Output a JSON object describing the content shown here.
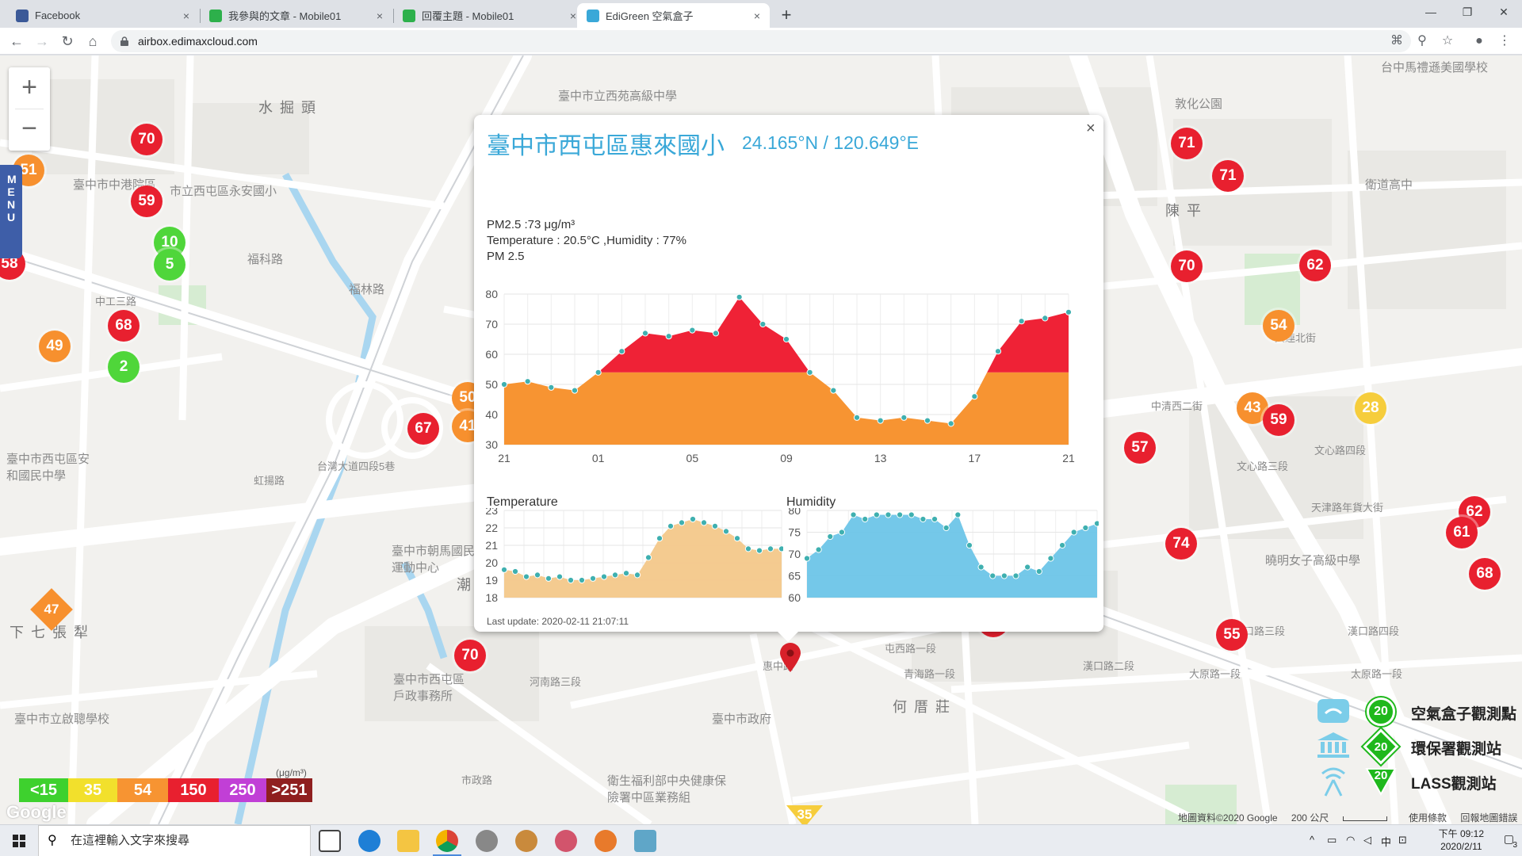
{
  "browser": {
    "tabs": [
      {
        "title": "Facebook",
        "icon": "facebook-icon",
        "color": "#3b5998"
      },
      {
        "title": "我參與的文章 - Mobile01",
        "icon": "mobile01-icon",
        "color": "#2db04b"
      },
      {
        "title": "回覆主題 - Mobile01",
        "icon": "mobile01-icon",
        "color": "#2db04b"
      },
      {
        "title": "EdiGreen 空氣盒子",
        "icon": "edigreen-icon",
        "color": "#3aa8d8"
      }
    ],
    "active_tab": 3,
    "url": "airbox.edimaxcloud.com",
    "new_tab_symbol": "+",
    "close_symbol": "×"
  },
  "map": {
    "zoom_in": "+",
    "zoom_out": "−",
    "menu_label": "MENU",
    "place_labels": [
      "水 掘 頭",
      "臺中市立西苑高級中學",
      "市立西屯區永安國小",
      "臺中市中港院區",
      "福科路",
      "福林路",
      "敦化公園",
      "臺中市西屯區安和國民中學",
      "台灣大道四段5巷",
      "虹揚路",
      "臺中市朝馬國民運動中心",
      "下 七 張 犁",
      "臺中市立啟聰學校",
      "臺中市西屯區戶政事務所",
      "臺中市政府",
      "衛生福利部中央健康保險署中區業務組",
      "何 厝 莊",
      "陳 平",
      "衛道高中",
      "台中馬禮遜美國學校",
      "文心路三段",
      "文心路四段",
      "天津路年貨大街",
      "曉明女子高級中學",
      "漢口路三段",
      "漢口路四段",
      "太原路一段",
      "大原路一段",
      "中清西二街",
      "大連北街",
      "潮",
      "屯西路一段",
      "青海路一段",
      "市政路",
      "惠中路",
      "河南路三段",
      "中工三路",
      "漢口路二段"
    ],
    "markers": [
      {
        "value": "51",
        "level": "orange"
      },
      {
        "value": "70",
        "level": "red"
      },
      {
        "value": "59",
        "level": "red"
      },
      {
        "value": "10",
        "level": "green"
      },
      {
        "value": "5",
        "level": "green"
      },
      {
        "value": "58",
        "level": "red"
      },
      {
        "value": "68",
        "level": "red"
      },
      {
        "value": "49",
        "level": "orange"
      },
      {
        "value": "2",
        "level": "green"
      },
      {
        "value": "50",
        "level": "orange"
      },
      {
        "value": "41",
        "level": "orange"
      },
      {
        "value": "67",
        "level": "red"
      },
      {
        "value": "71",
        "level": "red"
      },
      {
        "value": "71",
        "level": "red"
      },
      {
        "value": "70",
        "level": "red"
      },
      {
        "value": "62",
        "level": "red"
      },
      {
        "value": "54",
        "level": "orange"
      },
      {
        "value": "43",
        "level": "orange"
      },
      {
        "value": "59",
        "level": "red"
      },
      {
        "value": "28",
        "level": "yellow"
      },
      {
        "value": "57",
        "level": "red"
      },
      {
        "value": "74",
        "level": "red"
      },
      {
        "value": "62",
        "level": "red"
      },
      {
        "value": "61",
        "level": "red"
      },
      {
        "value": "68",
        "level": "red"
      },
      {
        "value": "62",
        "level": "red"
      },
      {
        "value": "55",
        "level": "red"
      },
      {
        "value": "70",
        "level": "red"
      },
      {
        "value": "64",
        "level": "red"
      },
      {
        "value": "73",
        "level": "red"
      },
      {
        "value": "47",
        "level": "orange"
      },
      {
        "value": "35",
        "level": "yellow"
      }
    ],
    "legend": {
      "unit": "(μg/m³)",
      "items": [
        {
          "label": "<15",
          "color": "#3ed12e"
        },
        {
          "label": "35",
          "color": "#f2e02c"
        },
        {
          "label": "54",
          "color": "#f79432"
        },
        {
          "label": "150",
          "color": "#e8202f"
        },
        {
          "label": "250",
          "color": "#c13fd6"
        },
        {
          "label": ">251",
          "color": "#8f1f1f"
        }
      ]
    },
    "station_legend": [
      {
        "label": "空氣盒子觀測點",
        "icon": "airbox-icon",
        "value": "20"
      },
      {
        "label": "環保署觀測站",
        "icon": "epa-building-icon",
        "value": "20"
      },
      {
        "label": "LASS觀測站",
        "icon": "lass-antenna-icon",
        "value": "20"
      }
    ],
    "google_logo": "Google",
    "footer": {
      "attribution": "地圖資料©2020 Google",
      "scale": "200 公尺",
      "terms": "使用條款",
      "report": "回報地圖錯誤"
    }
  },
  "info": {
    "close": "×",
    "station_name": "臺中市西屯區惠來國小",
    "coords": "24.165°N / 120.649°E",
    "pm25_line": "PM2.5 :73 μg/m³",
    "temp_hum_line": "Temperature : 20.5°C ,Humidity : 77%",
    "pm_title": "PM 2.5",
    "temp_title": "Temperature",
    "hum_title": "Humidity",
    "last_update": "Last update: 2020-02-11 21:07:11"
  },
  "chart_data": [
    {
      "type": "area",
      "title": "PM 2.5",
      "x_ticks": [
        "21",
        "01",
        "05",
        "09",
        "13",
        "17",
        "21"
      ],
      "ylim": [
        30,
        80
      ],
      "y_ticks": [
        30,
        40,
        50,
        60,
        70,
        80
      ],
      "threshold": 54,
      "threshold_colors": {
        "below": "#f79432",
        "above": "#ef2236"
      },
      "values": [
        50,
        51,
        49,
        48,
        54,
        61,
        67,
        66,
        68,
        67,
        79,
        70,
        65,
        54,
        48,
        39,
        38,
        39,
        38,
        37,
        46,
        61,
        71,
        72,
        74
      ]
    },
    {
      "type": "area",
      "title": "Temperature",
      "ylim": [
        18,
        23
      ],
      "y_ticks": [
        18,
        19,
        20,
        21,
        22,
        23
      ],
      "color": "#f3c88a",
      "values": [
        19.6,
        19.5,
        19.2,
        19.3,
        19.1,
        19.2,
        19.0,
        19.0,
        19.1,
        19.2,
        19.3,
        19.4,
        19.3,
        20.3,
        21.4,
        22.1,
        22.3,
        22.5,
        22.3,
        22.1,
        21.8,
        21.4,
        20.8,
        20.7,
        20.8,
        20.8
      ]
    },
    {
      "type": "area",
      "title": "Humidity",
      "ylim": [
        60,
        80
      ],
      "y_ticks": [
        60,
        65,
        70,
        75,
        80
      ],
      "color": "#6dc5e8",
      "values": [
        69,
        71,
        74,
        75,
        79,
        78,
        79,
        79,
        79,
        79,
        78,
        78,
        76,
        79,
        72,
        67,
        65,
        65,
        65,
        67,
        66,
        69,
        72,
        75,
        76,
        77
      ]
    }
  ],
  "taskbar": {
    "search_placeholder": "在這裡輸入文字來搜尋",
    "time": "下午 09:12",
    "date": "2020/2/11",
    "ime": "中",
    "notifications": "3"
  }
}
